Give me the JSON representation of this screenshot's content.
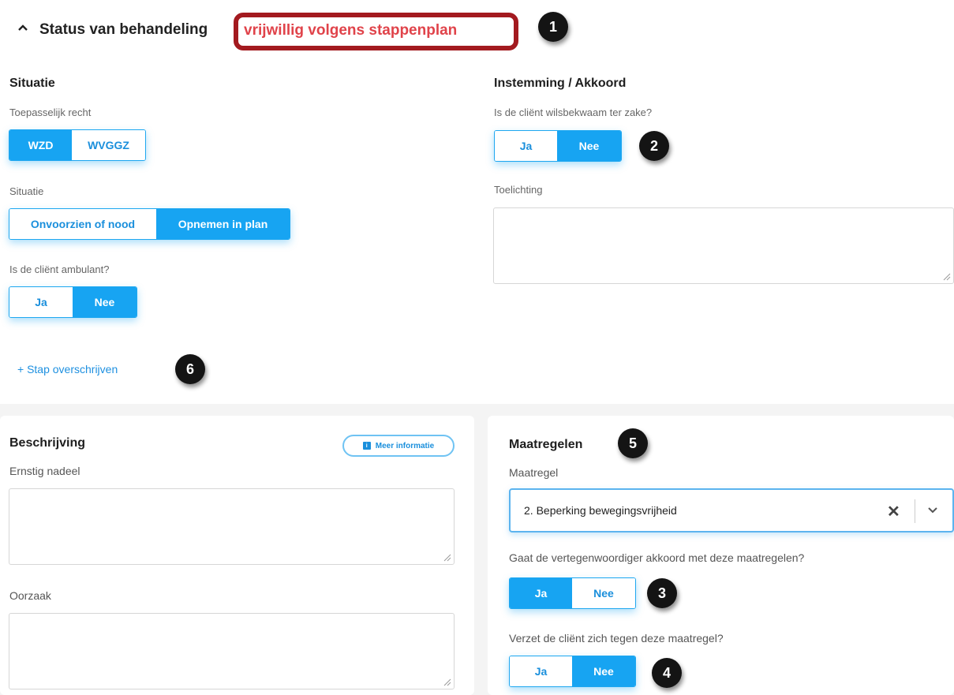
{
  "header": {
    "title": "Status van behandeling",
    "status": "vrijwillig volgens stappenplan"
  },
  "badges": [
    "1",
    "2",
    "3",
    "4",
    "5",
    "6"
  ],
  "situatie": {
    "title": "Situatie",
    "recht_label": "Toepasselijk recht",
    "recht_options": [
      "WZD",
      "WVGGZ"
    ],
    "situatie_label": "Situatie",
    "situatie_options": [
      "Onvoorzien of nood",
      "Opnemen in plan"
    ],
    "ambulant_label": "Is de cliënt ambulant?",
    "ambulant_options": [
      "Ja",
      "Nee"
    ]
  },
  "instemming": {
    "title": "Instemming / Akkoord",
    "wils_label": "Is de cliënt wilsbekwaam ter zake?",
    "wils_options": [
      "Ja",
      "Nee"
    ],
    "toelichting_label": "Toelichting",
    "toelichting_value": ""
  },
  "stap_link": "+ Stap overschrijven",
  "beschrijving": {
    "title": "Beschrijving",
    "meer_info": "Meer informatie",
    "nadeel_label": "Ernstig nadeel",
    "nadeel_value": "",
    "oorzaak_label": "Oorzaak",
    "oorzaak_value": ""
  },
  "maatregelen": {
    "title": "Maatregelen",
    "maatregel_label": "Maatregel",
    "maatregel_value": "2. Beperking bewegingsvrijheid",
    "akkoord_label": "Gaat de vertegenwoordiger akkoord met deze maatregelen?",
    "akkoord_options": [
      "Ja",
      "Nee"
    ],
    "verzet_label": "Verzet de cliënt zich tegen deze maatregel?",
    "verzet_options": [
      "Ja",
      "Nee"
    ]
  },
  "colors": {
    "accent": "#17a4f2",
    "status_red": "#e0434a",
    "status_border": "#a31a1f",
    "badge": "#141414"
  },
  "icons": [
    "chevron-up-icon",
    "plus-icon",
    "info-icon",
    "clear-icon",
    "chevron-down-icon",
    "resize-handle-icon"
  ]
}
